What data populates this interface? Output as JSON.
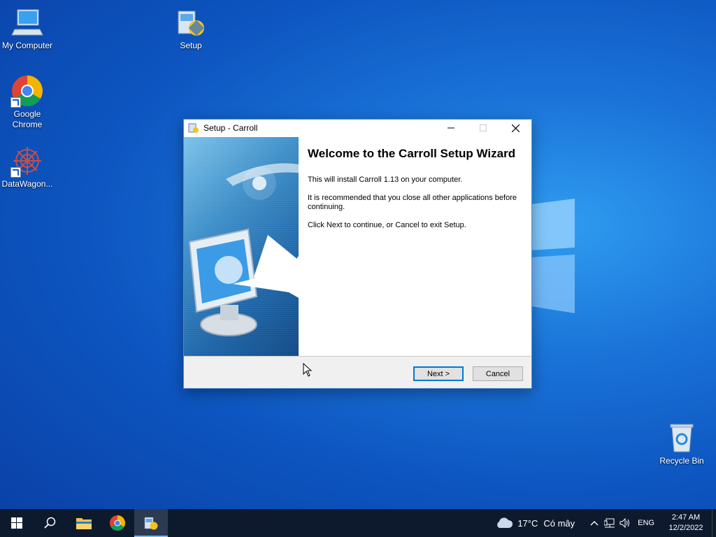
{
  "desktop": {
    "icons": [
      {
        "label": "My Computer"
      },
      {
        "label": "Setup"
      },
      {
        "label_line1": "Google",
        "label_line2": "Chrome"
      },
      {
        "label": "DataWagon..."
      },
      {
        "label": "Recycle Bin"
      }
    ]
  },
  "dialog": {
    "title": "Setup - Carroll",
    "heading": "Welcome to the Carroll Setup Wizard",
    "paragraphs": [
      "This will install Carroll 1.13 on your computer.",
      "It is recommended that you close all other applications before continuing.",
      "Click Next to continue, or Cancel to exit Setup."
    ],
    "next_label": "Next >",
    "cancel_label": "Cancel"
  },
  "taskbar": {
    "weather": {
      "temp": "17°C",
      "desc": "Có mây"
    },
    "language": "ENG",
    "time": "2:47 AM",
    "date": "12/2/2022"
  },
  "colors": {
    "accent": "#0078d7",
    "taskbar": "#0d1a2e"
  }
}
